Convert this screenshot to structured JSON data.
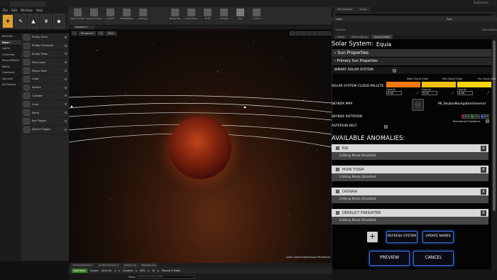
{
  "window": {
    "title": "Subverse",
    "tab": "Subverse"
  },
  "menu": [
    "File",
    "Edit",
    "Window",
    "Help"
  ],
  "modes": [
    "place-mode",
    "paint-mode",
    "landscape-mode",
    "foliage-mode",
    "geometry-mode"
  ],
  "place_panel": {
    "categories": [
      "Recently Placed",
      "Basic",
      "Lights",
      "Cinematic",
      "Visual Effects",
      "Media",
      "Geometry",
      "Volumes",
      "All Classes"
    ],
    "active_category": "Basic",
    "items": [
      "Empty Actor",
      "Empty Character",
      "Empty Pawn",
      "Point Light",
      "Player Start",
      "Cube",
      "Sphere",
      "Cylinder",
      "Cone",
      "Plane",
      "Box Trigger",
      "Sphere Trigger"
    ]
  },
  "toolbar": [
    "Save Current",
    "Source Control",
    "Content",
    "Marketplace",
    "Settings",
    "Blueprints",
    "Cinematics",
    "Build",
    "Compile",
    "Play",
    "Launch"
  ],
  "viewport": {
    "tab": "Viewport 1",
    "mode_buttons": [
      "Perspective",
      "Lit",
      "Show"
    ],
    "level_label": "Level: SolarSystemEquia (Persistent)"
  },
  "content_browser": {
    "tabs": [
      "Content Browser 1",
      "Content Browser 2",
      "Output Log",
      "Message Log"
    ],
    "add_new": "Add New",
    "import": "Import",
    "save_all": "Save All",
    "breadcrumb": [
      "Content",
      "DEV",
      "UI",
      "Planet-O-Matic"
    ],
    "filters": "Filters",
    "search_placeholder": "Search Planet-O-Matic"
  },
  "outliner": {
    "tabs": [
      "World Outliner",
      "Layers"
    ],
    "col_label": "Label",
    "col_type": "Type",
    "count": "14 actors",
    "view_options": "View Options"
  },
  "details_tabs": [
    "Details",
    "World Settings",
    "Planet-O-Matic"
  ],
  "details_active_tab": "Planet-O-Matic",
  "solar_system": {
    "label": "Solar System:",
    "name": "Equia",
    "sun_properties": "Sun Properties",
    "primary_sun_properties": "Primary Sun Properties",
    "binary_label": "BINARY SOLAR SYSTEM",
    "cloud_label": "SOLAR SYSTEM CLOUD PALLETE",
    "clouds": [
      {
        "title": "Near Cloud Color",
        "color": "#f07a10",
        "opacity_label": "Opacity",
        "opacity": "0.05"
      },
      {
        "title": "Mid Cloud Color",
        "color": "#f2c012",
        "opacity_label": "Opacity",
        "opacity": "0.02"
      },
      {
        "title": "Far Cloud Color",
        "color": "#f5d514",
        "opacity_label": "Opacity",
        "opacity": "0.04"
      }
    ],
    "skybox_label": "SKYBOX MAP",
    "skybox_value": "MI_SkyboxNavigationGeneral",
    "skybox_rotation_label": "SKYBOX ROTATION",
    "rotation": [
      "0.0",
      "0.0",
      "0.0"
    ],
    "randomize_rotation": "Randomize Rotation",
    "asteroid_belt": "ASTEROID BELT"
  },
  "anomalies": {
    "title": "AVAILABLE ANOMALIES:",
    "list": [
      {
        "name": "RIA",
        "status": "Editing Mode Disabled"
      },
      {
        "name": "MONI TISSIA",
        "status": "Editing Mode Disabled"
      },
      {
        "name": "DIGNAIA",
        "status": "Editing Mode Disabled"
      },
      {
        "name": "DERELICT FREIGHTER",
        "status": "Editing Mode Disabled"
      }
    ]
  },
  "buttons": {
    "plus": "+",
    "refresh": "REFRESH SYSTEM",
    "update": "UPDATE NAMES",
    "preview": "PREVIEW",
    "cancel": "CANCEL",
    "close_x": "X"
  },
  "colors": {
    "accent_blue": "#3a6ad8",
    "add_new_green": "#3d7d2a",
    "active_mode": "#e0a030"
  }
}
